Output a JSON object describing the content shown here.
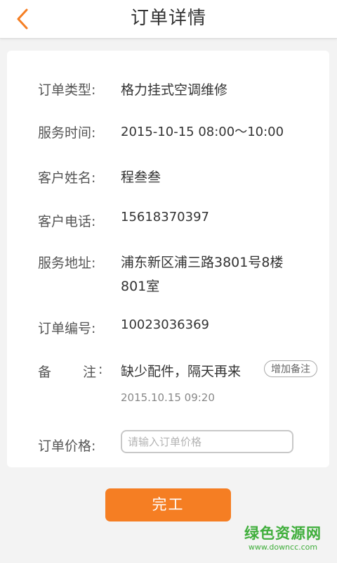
{
  "header": {
    "title": "订单详情"
  },
  "order": {
    "type_label": "订单类型:",
    "type_value": "格力挂式空调维修",
    "time_label": "服务时间:",
    "time_value": "2015-10-15  08:00～10:00",
    "name_label": "客户姓名:",
    "name_value": "程叁叁",
    "phone_label": "客户电话:",
    "phone_value": "15618370397",
    "address_label": "服务地址:",
    "address_line1": "浦东新区浦三路3801号8楼",
    "address_line2": "801室",
    "number_label": "订单编号:",
    "number_value": "10023036369",
    "remark_label_char1": "备",
    "remark_label_char2": "注",
    "remark_label_colon": ":",
    "remark_value": "缺少配件，隔天再来",
    "remark_add_button": "增加备注",
    "remark_time": "2015.10.15  09:20",
    "price_label": "订单价格:",
    "price_value": "",
    "price_placeholder": "请输入订单价格"
  },
  "actions": {
    "complete_label": "完工"
  },
  "watermark": {
    "main": "绿色资源网",
    "sub": "www.downcc.com"
  },
  "icons": {
    "back": "chevron-left-icon"
  },
  "colors": {
    "accent": "#f57e23",
    "background": "#f3f3f3",
    "watermark": "#3fae3b"
  }
}
